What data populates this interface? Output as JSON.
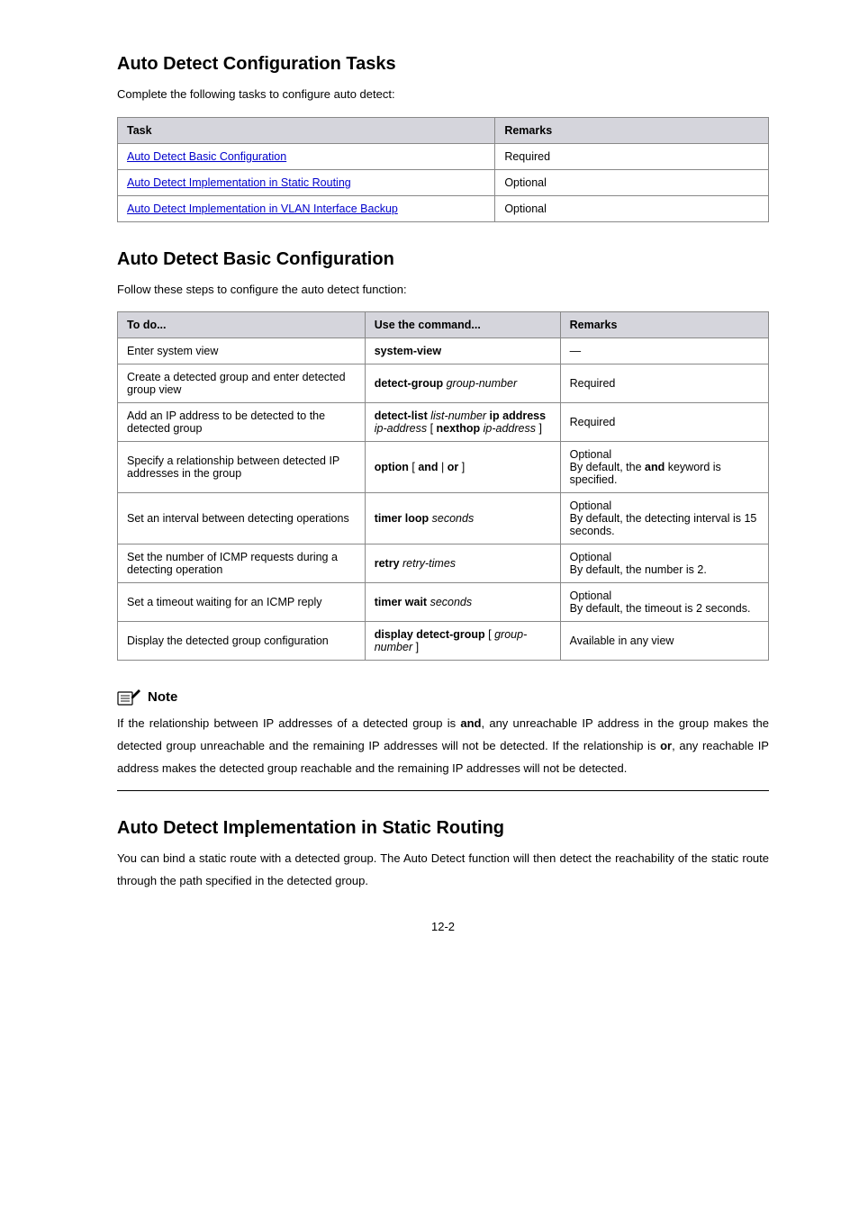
{
  "heading1": "Auto Detect Configuration Tasks",
  "para1": "Complete the following tasks to configure auto detect:",
  "table1": {
    "headers": [
      "Task",
      "Remarks"
    ],
    "rows": [
      [
        "Auto Detect Basic Configuration",
        "Required"
      ],
      [
        "Auto Detect Implementation in Static Routing",
        "Optional"
      ],
      [
        "Auto Detect Implementation in VLAN Interface Backup",
        "Optional"
      ]
    ]
  },
  "heading2": "Auto Detect Basic Configuration",
  "para2": "Follow these steps to configure the auto detect function:",
  "table2": {
    "headers": [
      "To do...",
      "Use the command...",
      "Remarks"
    ],
    "rows": [
      {
        "todo": "Enter system view",
        "cmd": "system-view",
        "rmk": "—"
      },
      {
        "todo": "Create a detected group and enter detected group view",
        "cmd_parts": [
          {
            "text": "detect-group ",
            "b": true
          },
          {
            "text": "group-number",
            "i": true
          }
        ],
        "rmk": "Required"
      },
      {
        "todo": "Add an IP address to be detected to the detected group",
        "cmd_parts": [
          {
            "text": "detect-list ",
            "b": true
          },
          {
            "text": "list-number ",
            "i": true
          },
          {
            "text": "ip address ",
            "b": true
          },
          {
            "text": "ip-address ",
            "i": true
          },
          {
            "text": "[ "
          },
          {
            "text": "nexthop ",
            "b": true
          },
          {
            "text": "ip-address ",
            "i": true
          },
          {
            "text": "]"
          }
        ],
        "rmk": "Required"
      },
      {
        "todo": "Specify a relationship between detected IP addresses in the group",
        "cmd_parts": [
          {
            "text": "option ",
            "b": true
          },
          {
            "text": "[ "
          },
          {
            "text": "and ",
            "b": true
          },
          {
            "text": "| "
          },
          {
            "text": "or ",
            "b": true
          },
          {
            "text": "]"
          }
        ],
        "rmk_parts": [
          {
            "text": "Optional\n"
          },
          {
            "text": "By default, the "
          },
          {
            "text": "and",
            "b": true
          },
          {
            "text": " keyword is specified."
          }
        ]
      },
      {
        "todo": "Set an interval between detecting operations",
        "cmd_parts": [
          {
            "text": "timer loop ",
            "b": true
          },
          {
            "text": "seconds",
            "i": true
          }
        ],
        "rmk_parts": [
          {
            "text": "Optional\n"
          },
          {
            "text": "By default, the detecting interval is 15 seconds."
          }
        ]
      },
      {
        "todo": "Set the number of ICMP requests during a detecting operation",
        "cmd_parts": [
          {
            "text": "retry ",
            "b": true
          },
          {
            "text": "retry-times",
            "i": true
          }
        ],
        "rmk_parts": [
          {
            "text": "Optional\n"
          },
          {
            "text": "By default, the number is 2."
          }
        ]
      },
      {
        "todo": "Set a timeout waiting for an ICMP reply",
        "cmd_parts": [
          {
            "text": "timer wait ",
            "b": true
          },
          {
            "text": "seconds",
            "i": true
          }
        ],
        "rmk_parts": [
          {
            "text": "Optional\n"
          },
          {
            "text": "By default, the timeout is 2 seconds."
          }
        ]
      },
      {
        "todo": "Display the detected group configuration",
        "cmd_parts": [
          {
            "text": "display detect-group ",
            "b": true
          },
          {
            "text": "[ "
          },
          {
            "text": "group-number ",
            "i": true
          },
          {
            "text": "]"
          }
        ],
        "rmk": "Available in any view"
      }
    ]
  },
  "note": {
    "label": " Note",
    "body_pre": "If the relationship between IP addresses of a detected group is ",
    "kw1": "and",
    "body_mid1": ", any unreachable IP address in the group makes the detected group unreachable and the remaining IP addresses will not be detected. If the relationship is ",
    "kw2": "or",
    "body_post": ", any reachable IP address makes the detected group reachable and the remaining IP addresses will not be detected."
  },
  "heading3": "Auto Detect Implementation in Static Routing",
  "para3": "You can bind a static route with a detected group. The Auto Detect function will then detect the reachability of the static route through the path specified in the detected group.",
  "pagenum": "12-2"
}
